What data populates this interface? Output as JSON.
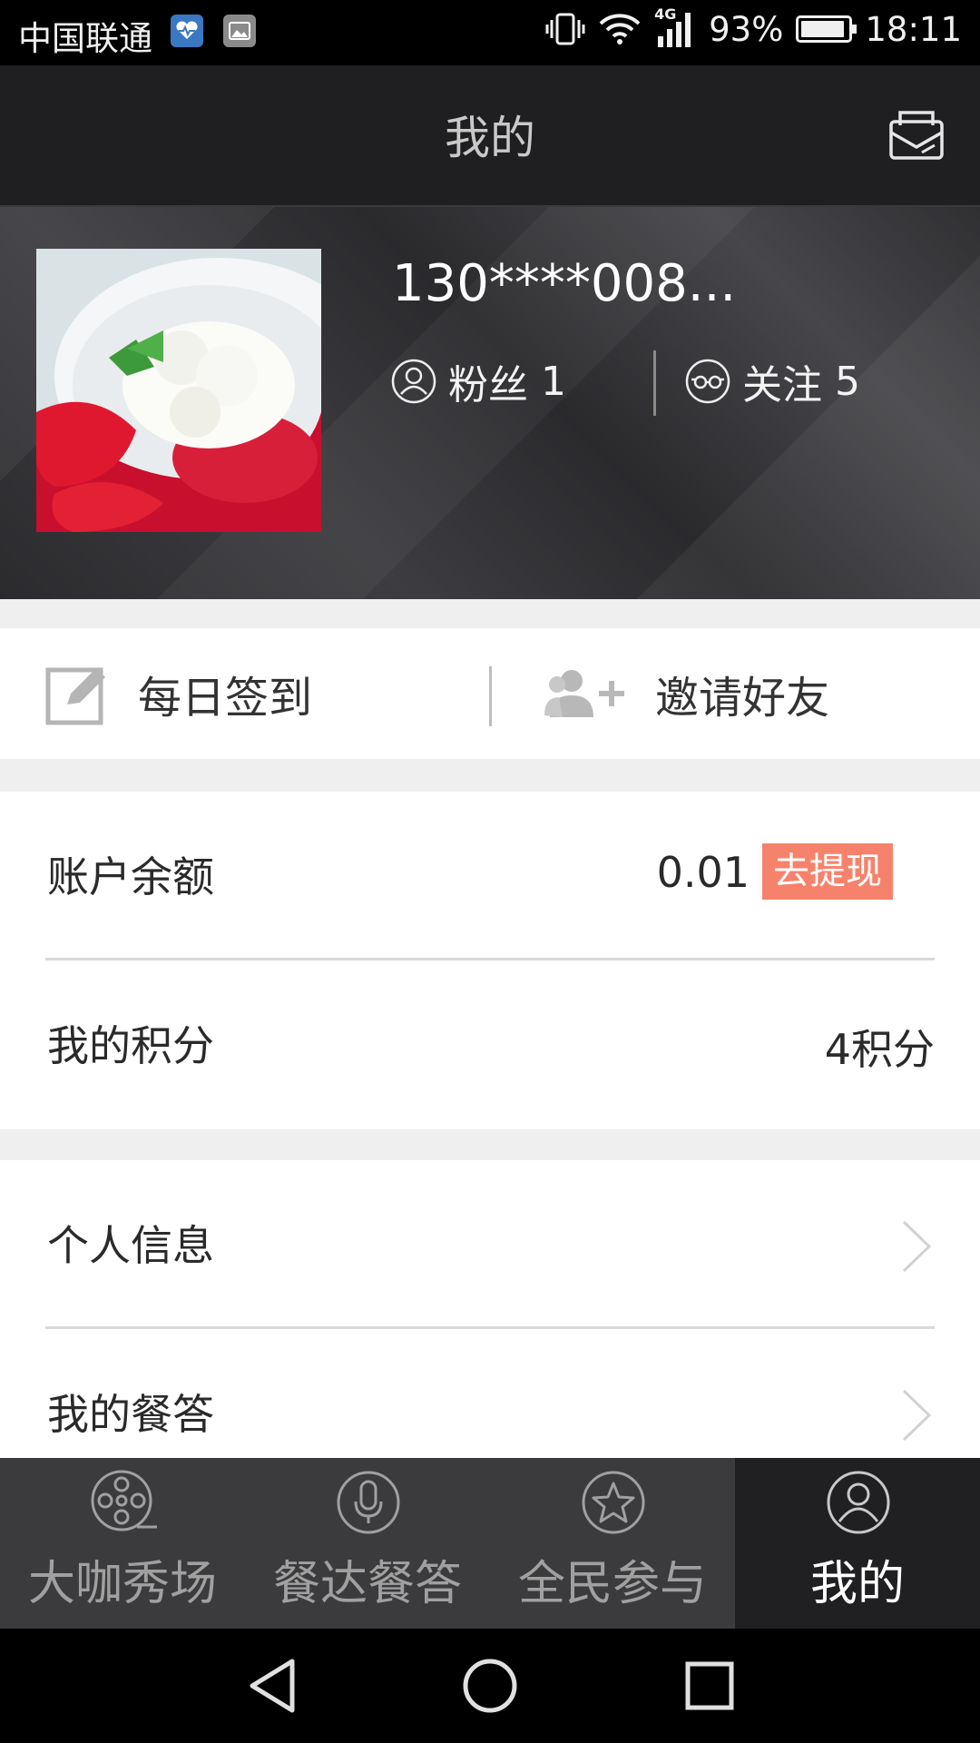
{
  "status_bar": {
    "carrier": "中国联通",
    "network": "4G",
    "battery": "93%",
    "time": "18:11"
  },
  "header": {
    "title": "我的",
    "mail_icon": "mail-icon"
  },
  "profile": {
    "username": "130****008...",
    "fans_label": "粉丝",
    "fans_count": "1",
    "follow_label": "关注",
    "follow_count": "5"
  },
  "actions": {
    "checkin": "每日签到",
    "invite": "邀请好友"
  },
  "balance": {
    "label": "账户余额",
    "value": "0.01",
    "withdraw": "去提现"
  },
  "points": {
    "label": "我的积分",
    "value": "4积分"
  },
  "menu": {
    "personal_info": "个人信息",
    "my_answers": "我的餐答"
  },
  "tabs": [
    {
      "label": "大咖秀场",
      "icon": "film-reel-icon"
    },
    {
      "label": "餐达餐答",
      "icon": "microphone-icon"
    },
    {
      "label": "全民参与",
      "icon": "star-icon"
    },
    {
      "label": "我的",
      "icon": "user-icon"
    }
  ],
  "colors": {
    "accent": "#f7826b",
    "header_bg": "#1f1f21",
    "tab_bg": "#3b3b3d",
    "tab_active_bg": "#202022"
  }
}
